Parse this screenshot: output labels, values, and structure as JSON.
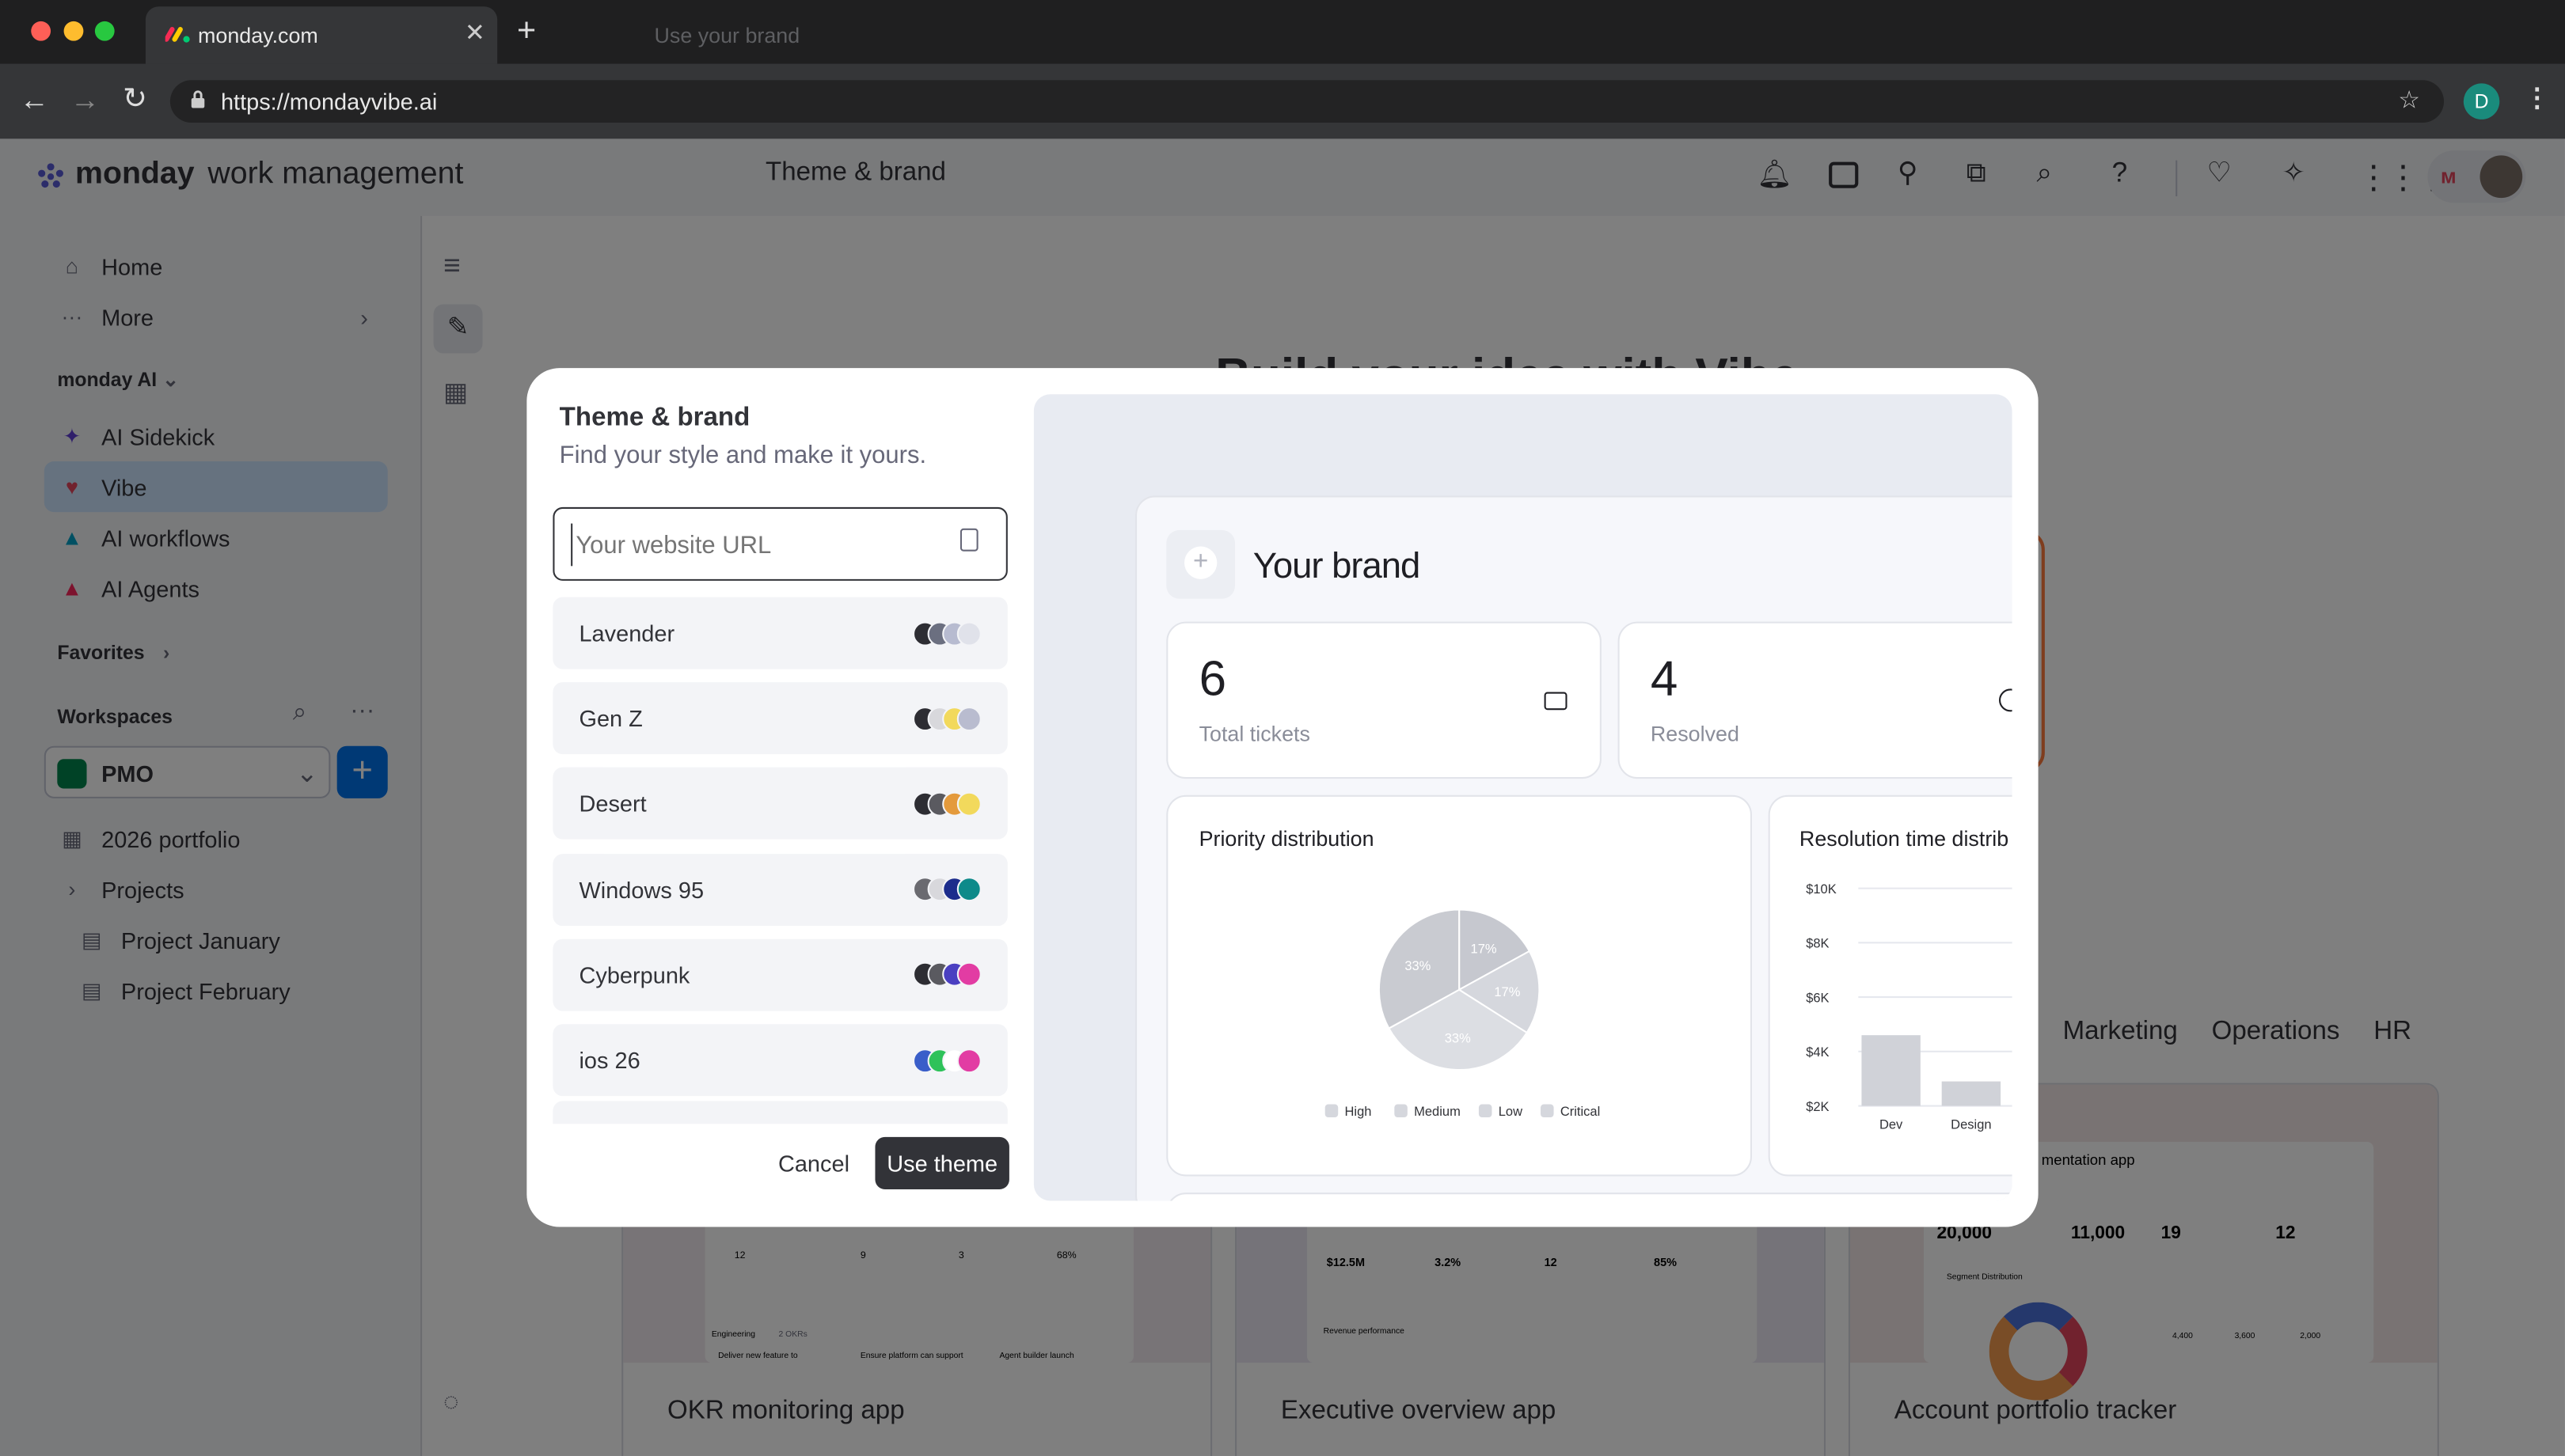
{
  "browser": {
    "tab_title": "monday.com",
    "ghost_tab": "Use your brand",
    "url": "https://mondayvibe.ai",
    "profile_initial": "D"
  },
  "app": {
    "brand_bold": "monday",
    "brand_rest": "work management",
    "page_title": "Theme & brand"
  },
  "sidebar": {
    "top": [
      {
        "label": "Home",
        "icon": "home-icon"
      },
      {
        "label": "More",
        "icon": "more-icon"
      }
    ],
    "ai_section": "monday AI",
    "ai_items": [
      {
        "label": "AI Sidekick",
        "icon": "sparkle-icon"
      },
      {
        "label": "Vibe",
        "icon": "heart-icon"
      },
      {
        "label": "AI workflows",
        "icon": "workflow-icon"
      },
      {
        "label": "AI Agents",
        "icon": "agent-icon"
      }
    ],
    "favorites": "Favorites",
    "workspaces": "Workspaces",
    "workspace_name": "PMO",
    "tree": [
      {
        "label": "2026 portfolio"
      },
      {
        "label": "Projects"
      },
      {
        "label": "Project January"
      },
      {
        "label": "Project February"
      }
    ]
  },
  "background": {
    "hero": "Build your idea with Vibe",
    "tabs": [
      "Marketing",
      "Operations",
      "HR"
    ],
    "cards": [
      {
        "title": "OKR monitoring app",
        "stats": [
          "12",
          "9",
          "3",
          "68%"
        ],
        "section": "Engineering",
        "sub": "2 OKRs",
        "rows": [
          "Deliver new feature to",
          "Ensure platform can support",
          "Agent builder launch"
        ]
      },
      {
        "title": "Executive overview app",
        "stats": [
          "$12.5M",
          "3.2%",
          "12",
          "85%"
        ],
        "section": "Revenue performance"
      },
      {
        "title": "Account portfolio tracker",
        "app": "mentation app",
        "stats": [
          "20,000",
          "11,000",
          "19",
          "12"
        ],
        "section": "Segment Distribution",
        "seg_stats": [
          "4,400",
          "3,600",
          "2,000"
        ]
      }
    ]
  },
  "modal": {
    "title": "Theme & brand",
    "subtitle": "Find your style and make it yours.",
    "url_placeholder": "Your website URL",
    "cancel": "Cancel",
    "apply": "Use theme",
    "themes": [
      {
        "name": "Lavender",
        "colors": [
          "#2d2d33",
          "#6b6f80",
          "#b7bbd0",
          "#e0e2ea"
        ]
      },
      {
        "name": "Gen Z",
        "colors": [
          "#2d2d33",
          "#d8d8dc",
          "#f2d95c",
          "#b9bccf"
        ]
      },
      {
        "name": "Desert",
        "colors": [
          "#2d2d33",
          "#5a5a60",
          "#e49a3c",
          "#f2d95c"
        ]
      },
      {
        "name": "Windows 95",
        "colors": [
          "#6a6a70",
          "#d8d8dc",
          "#1c2c8c",
          "#0e8a8a"
        ]
      },
      {
        "name": "Cyberpunk",
        "colors": [
          "#2d2d33",
          "#5a5a60",
          "#4a3fc1",
          "#e23ca3"
        ]
      },
      {
        "name": "ios 26",
        "colors": [
          "#3a5ec9",
          "#2ec25a",
          "#ffffff",
          "#e23ca3"
        ]
      }
    ]
  },
  "preview": {
    "brand": "Your brand",
    "kpis": [
      {
        "value": "6",
        "label": "Total tickets"
      },
      {
        "value": "4",
        "label": "Resolved"
      }
    ],
    "pie": {
      "title": "Priority distribution",
      "slices": [
        {
          "label": "17%",
          "value": 17
        },
        {
          "label": "17%",
          "value": 17
        },
        {
          "label": "33%",
          "value": 33
        },
        {
          "label": "33%",
          "value": 33
        }
      ],
      "legend": [
        "High",
        "Medium",
        "Low",
        "Critical"
      ]
    },
    "bar": {
      "title": "Resolution time distrib",
      "yticks": [
        "$10K",
        "$8K",
        "$6K",
        "$4K",
        "$2K"
      ],
      "categories": [
        "Dev",
        "Design"
      ],
      "values": [
        4.6,
        2.9
      ],
      "ylim": [
        2,
        10
      ]
    }
  },
  "colors": {
    "accent": "#0073ea",
    "overlay": "rgba(0,0,0,0.5)",
    "vibe_selected": "#cce5ff"
  }
}
